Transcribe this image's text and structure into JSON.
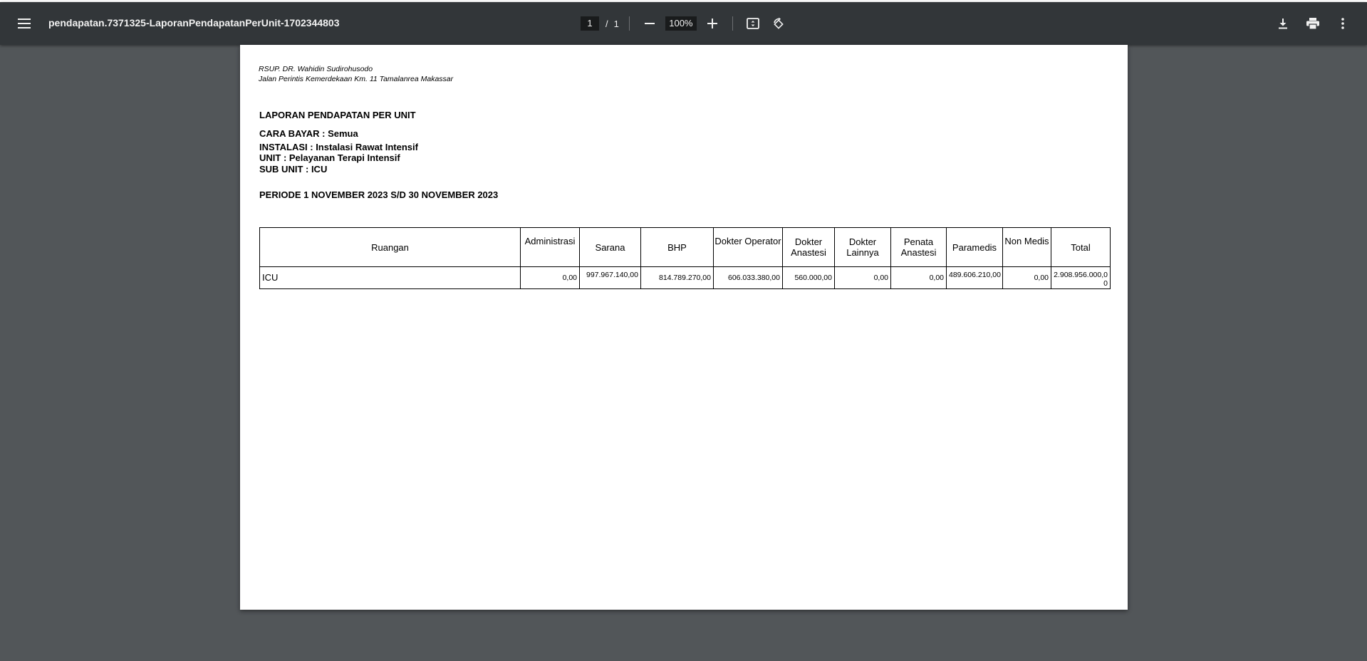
{
  "toolbar": {
    "title": "pendapatan.7371325-LaporanPendapatanPerUnit-1702344803",
    "page_current": "1",
    "page_sep": "/",
    "page_total": "1",
    "zoom": "100%"
  },
  "document": {
    "hospital_name": "RSUP. DR. Wahidin Sudirohusodo",
    "hospital_address": "Jalan Perintis Kemerdekaan Km. 11 Tamalanrea Makassar",
    "report_title": "LAPORAN PENDAPATAN PER UNIT",
    "cara_bayar": "CARA BAYAR : Semua",
    "instalasi": "INSTALASI : Instalasi Rawat Intensif",
    "unit": "UNIT : Pelayanan Terapi Intensif",
    "sub_unit": "SUB UNIT : ICU",
    "periode": "PERIODE 1 NOVEMBER 2023 S/D 30 NOVEMBER 2023"
  },
  "table": {
    "headers": {
      "ruangan": "Ruangan",
      "administrasi": "Administrasi",
      "sarana": "Sarana",
      "bhp": "BHP",
      "dokter_operator": "Dokter Operator",
      "dokter_anastesi": "Dokter Anastesi",
      "dokter_lainnya": "Dokter Lainnya",
      "penata_anastesi": "Penata Anastesi",
      "paramedis": "Paramedis",
      "non_medis": "Non Medis",
      "total": "Total"
    },
    "rows": [
      {
        "ruangan": "ICU",
        "administrasi": "0,00",
        "sarana": "997.967.140,00",
        "bhp": "814.789.270,00",
        "dokter_operator": "606.033.380,00",
        "dokter_anastesi": "560.000,00",
        "dokter_lainnya": "0,00",
        "penata_anastesi": "0,00",
        "paramedis": "489.606.210,00",
        "non_medis": "0,00",
        "total": "2.908.956.000,00"
      }
    ]
  },
  "icons": {
    "menu": "menu-icon",
    "zoom_out": "minus-icon",
    "zoom_in": "plus-icon",
    "fit": "fit-page-icon",
    "rotate": "rotate-icon",
    "download": "download-icon",
    "print": "print-icon",
    "more": "more-vertical-icon"
  },
  "colors": {
    "toolbar_bg": "#323639",
    "viewer_bg": "#525659",
    "page_bg": "#ffffff"
  }
}
